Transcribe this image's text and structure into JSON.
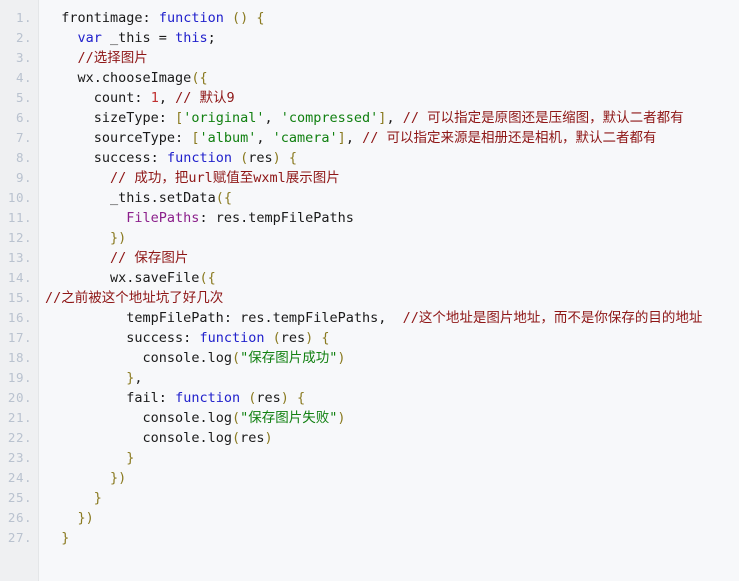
{
  "editor": {
    "name": "code-snippet-viewer",
    "language": "javascript",
    "line_count": 27,
    "colors": {
      "background": "#f7f8fa",
      "gutter_background": "#eff0f2",
      "gutter_border": "#e4e6e8",
      "line_number": "#b9c2cf",
      "text": "#1a1a1a",
      "keyword": "#2121cc",
      "string": "#118011",
      "comment": "#8e1616",
      "number": "#c03030",
      "property": "#8b1f8b",
      "punctuation": "#8a7a20"
    }
  },
  "line_numbers": [
    "1.",
    "2.",
    "3.",
    "4.",
    "5.",
    "6.",
    "7.",
    "8.",
    "9.",
    "10.",
    "11.",
    "12.",
    "13.",
    "14.",
    "15.",
    "16.",
    "17.",
    "18.",
    "19.",
    "20.",
    "21.",
    "22.",
    "23.",
    "24.",
    "25.",
    "26.",
    "27."
  ],
  "lines": [
    {
      "n": 1,
      "text": "  frontimage: function () {",
      "tokens": [
        {
          "t": "  ",
          "c": "plain"
        },
        {
          "t": "frontimage",
          "c": "plain"
        },
        {
          "t": ": ",
          "c": "plain"
        },
        {
          "t": "function",
          "c": "kw"
        },
        {
          "t": " ",
          "c": "plain"
        },
        {
          "t": "()",
          "c": "punc"
        },
        {
          "t": " ",
          "c": "plain"
        },
        {
          "t": "{",
          "c": "punc"
        }
      ]
    },
    {
      "n": 2,
      "text": "    var _this = this;",
      "tokens": [
        {
          "t": "    ",
          "c": "plain"
        },
        {
          "t": "var",
          "c": "kw"
        },
        {
          "t": " _this = ",
          "c": "plain"
        },
        {
          "t": "this",
          "c": "kw"
        },
        {
          "t": ";",
          "c": "plain"
        }
      ]
    },
    {
      "n": 3,
      "text": "    //选择图片",
      "tokens": [
        {
          "t": "    ",
          "c": "plain"
        },
        {
          "t": "//选择图片",
          "c": "com"
        }
      ]
    },
    {
      "n": 4,
      "text": "    wx.chooseImage({",
      "tokens": [
        {
          "t": "    wx.chooseImage",
          "c": "plain"
        },
        {
          "t": "({",
          "c": "punc"
        }
      ]
    },
    {
      "n": 5,
      "text": "      count: 1, // 默认9",
      "tokens": [
        {
          "t": "      count: ",
          "c": "plain"
        },
        {
          "t": "1",
          "c": "num"
        },
        {
          "t": ", ",
          "c": "plain"
        },
        {
          "t": "// 默认9",
          "c": "com"
        }
      ]
    },
    {
      "n": 6,
      "text": "      sizeType: ['original', 'compressed'], // 可以指定是原图还是压缩图，默认二者都有",
      "tokens": [
        {
          "t": "      sizeType: ",
          "c": "plain"
        },
        {
          "t": "[",
          "c": "punc"
        },
        {
          "t": "'original'",
          "c": "str"
        },
        {
          "t": ", ",
          "c": "plain"
        },
        {
          "t": "'compressed'",
          "c": "str"
        },
        {
          "t": "]",
          "c": "punc"
        },
        {
          "t": ", ",
          "c": "plain"
        },
        {
          "t": "// 可以指定是原图还是压缩图，默认二者都有",
          "c": "com"
        }
      ]
    },
    {
      "n": 7,
      "text": "      sourceType: ['album', 'camera'], // 可以指定来源是相册还是相机，默认二者都有",
      "tokens": [
        {
          "t": "      sourceType: ",
          "c": "plain"
        },
        {
          "t": "[",
          "c": "punc"
        },
        {
          "t": "'album'",
          "c": "str"
        },
        {
          "t": ", ",
          "c": "plain"
        },
        {
          "t": "'camera'",
          "c": "str"
        },
        {
          "t": "]",
          "c": "punc"
        },
        {
          "t": ", ",
          "c": "plain"
        },
        {
          "t": "// 可以指定来源是相册还是相机，默认二者都有",
          "c": "com"
        }
      ]
    },
    {
      "n": 8,
      "text": "      success: function (res) {",
      "tokens": [
        {
          "t": "      success: ",
          "c": "plain"
        },
        {
          "t": "function",
          "c": "kw"
        },
        {
          "t": " ",
          "c": "plain"
        },
        {
          "t": "(",
          "c": "punc"
        },
        {
          "t": "res",
          "c": "plain"
        },
        {
          "t": ")",
          "c": "punc"
        },
        {
          "t": " ",
          "c": "plain"
        },
        {
          "t": "{",
          "c": "punc"
        }
      ]
    },
    {
      "n": 9,
      "text": "        // 成功，把url赋值至wxml展示图片",
      "tokens": [
        {
          "t": "        ",
          "c": "plain"
        },
        {
          "t": "// 成功，把url赋值至wxml展示图片",
          "c": "com"
        }
      ]
    },
    {
      "n": 10,
      "text": "        _this.setData({",
      "tokens": [
        {
          "t": "        _this.setData",
          "c": "plain"
        },
        {
          "t": "({",
          "c": "punc"
        }
      ]
    },
    {
      "n": 11,
      "text": "          FilePaths: res.tempFilePaths",
      "tokens": [
        {
          "t": "          ",
          "c": "plain"
        },
        {
          "t": "FilePaths",
          "c": "prop"
        },
        {
          "t": ": res.tempFilePaths",
          "c": "plain"
        }
      ]
    },
    {
      "n": 12,
      "text": "        })",
      "tokens": [
        {
          "t": "        ",
          "c": "plain"
        },
        {
          "t": "})",
          "c": "punc"
        }
      ]
    },
    {
      "n": 13,
      "text": "        // 保存图片",
      "tokens": [
        {
          "t": "        ",
          "c": "plain"
        },
        {
          "t": "// 保存图片",
          "c": "com"
        }
      ]
    },
    {
      "n": 14,
      "text": "        wx.saveFile({",
      "tokens": [
        {
          "t": "        wx.saveFile",
          "c": "plain"
        },
        {
          "t": "({",
          "c": "punc"
        }
      ]
    },
    {
      "n": 15,
      "text": "//之前被这个地址坑了好几次",
      "tokens": [
        {
          "t": "//之前被这个地址坑了好几次",
          "c": "com"
        }
      ]
    },
    {
      "n": 16,
      "text": "          tempFilePath: res.tempFilePaths,  //这个地址是图片地址，而不是你保存的目的地址",
      "tokens": [
        {
          "t": "          tempFilePath: res.tempFilePaths,  ",
          "c": "plain"
        },
        {
          "t": "//这个地址是图片地址，而不是你保存的目的地址",
          "c": "com"
        }
      ]
    },
    {
      "n": 17,
      "text": "          success: function (res) {",
      "tokens": [
        {
          "t": "          success: ",
          "c": "plain"
        },
        {
          "t": "function",
          "c": "kw"
        },
        {
          "t": " ",
          "c": "plain"
        },
        {
          "t": "(",
          "c": "punc"
        },
        {
          "t": "res",
          "c": "plain"
        },
        {
          "t": ")",
          "c": "punc"
        },
        {
          "t": " ",
          "c": "plain"
        },
        {
          "t": "{",
          "c": "punc"
        }
      ]
    },
    {
      "n": 18,
      "text": "            console.log(\"保存图片成功\")",
      "tokens": [
        {
          "t": "            console.log",
          "c": "plain"
        },
        {
          "t": "(",
          "c": "punc"
        },
        {
          "t": "\"保存图片成功\"",
          "c": "str"
        },
        {
          "t": ")",
          "c": "punc"
        }
      ]
    },
    {
      "n": 19,
      "text": "          },",
      "tokens": [
        {
          "t": "          ",
          "c": "plain"
        },
        {
          "t": "}",
          "c": "punc"
        },
        {
          "t": ",",
          "c": "plain"
        }
      ]
    },
    {
      "n": 20,
      "text": "          fail: function (res) {",
      "tokens": [
        {
          "t": "          fail: ",
          "c": "plain"
        },
        {
          "t": "function",
          "c": "kw"
        },
        {
          "t": " ",
          "c": "plain"
        },
        {
          "t": "(",
          "c": "punc"
        },
        {
          "t": "res",
          "c": "plain"
        },
        {
          "t": ")",
          "c": "punc"
        },
        {
          "t": " ",
          "c": "plain"
        },
        {
          "t": "{",
          "c": "punc"
        }
      ]
    },
    {
      "n": 21,
      "text": "            console.log(\"保存图片失败\")",
      "tokens": [
        {
          "t": "            console.log",
          "c": "plain"
        },
        {
          "t": "(",
          "c": "punc"
        },
        {
          "t": "\"保存图片失败\"",
          "c": "str"
        },
        {
          "t": ")",
          "c": "punc"
        }
      ]
    },
    {
      "n": 22,
      "text": "            console.log(res)",
      "tokens": [
        {
          "t": "            console.log",
          "c": "plain"
        },
        {
          "t": "(",
          "c": "punc"
        },
        {
          "t": "res",
          "c": "plain"
        },
        {
          "t": ")",
          "c": "punc"
        }
      ]
    },
    {
      "n": 23,
      "text": "          }",
      "tokens": [
        {
          "t": "          ",
          "c": "plain"
        },
        {
          "t": "}",
          "c": "punc"
        }
      ]
    },
    {
      "n": 24,
      "text": "        })",
      "tokens": [
        {
          "t": "        ",
          "c": "plain"
        },
        {
          "t": "})",
          "c": "punc"
        }
      ]
    },
    {
      "n": 25,
      "text": "      }",
      "tokens": [
        {
          "t": "      ",
          "c": "plain"
        },
        {
          "t": "}",
          "c": "punc"
        }
      ]
    },
    {
      "n": 26,
      "text": "    })",
      "tokens": [
        {
          "t": "    ",
          "c": "plain"
        },
        {
          "t": "})",
          "c": "punc"
        }
      ]
    },
    {
      "n": 27,
      "text": "  }",
      "tokens": [
        {
          "t": "  ",
          "c": "plain"
        },
        {
          "t": "}",
          "c": "punc"
        }
      ]
    }
  ]
}
